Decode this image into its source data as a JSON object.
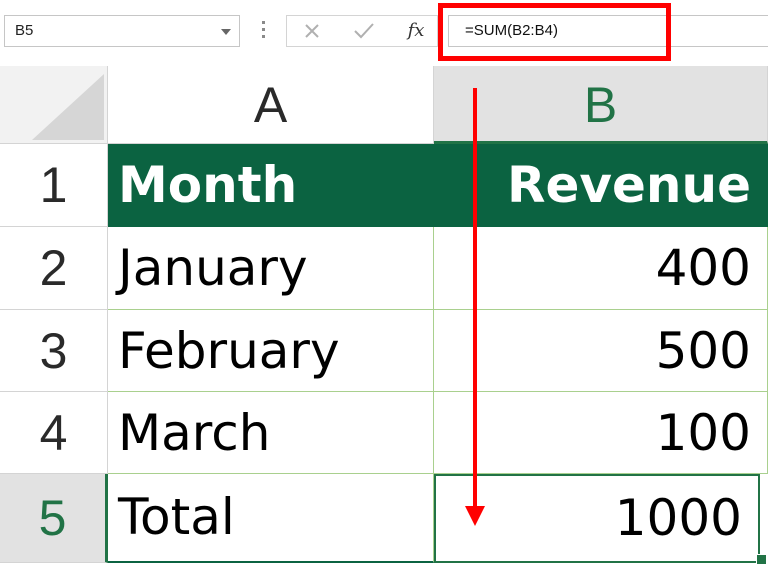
{
  "name_box": {
    "value": "B5"
  },
  "formula_bar": {
    "formula": "=SUM(B2:B4)",
    "fx_label": "fx"
  },
  "columns": [
    {
      "label": "A"
    },
    {
      "label": "B"
    }
  ],
  "rows": [
    {
      "num": "1",
      "a": "Month",
      "b": "Revenue"
    },
    {
      "num": "2",
      "a": "January",
      "b": "400"
    },
    {
      "num": "3",
      "a": "February",
      "b": "500"
    },
    {
      "num": "4",
      "a": "March",
      "b": "100"
    },
    {
      "num": "5",
      "a": "Total",
      "b": "1000"
    }
  ],
  "selected_cell": "B5",
  "colors": {
    "header_fill": "#0b6341",
    "excel_green": "#217346",
    "annotation_red": "#ff0000"
  }
}
